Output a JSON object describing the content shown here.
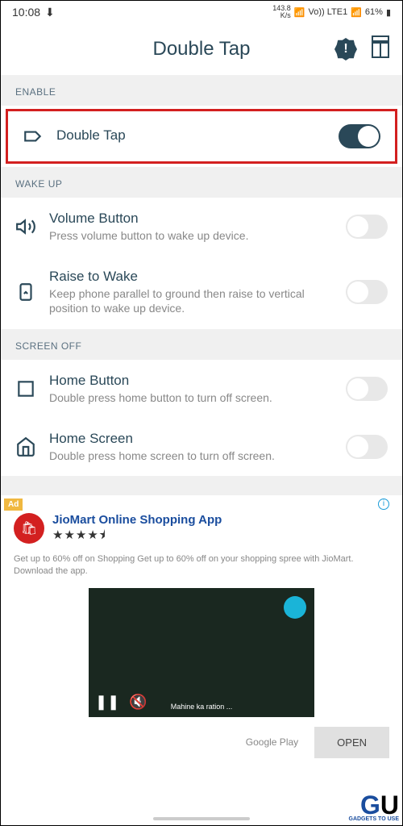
{
  "status": {
    "time": "10:08",
    "speed": "143.8\nK/s",
    "network": "Vo)) LTE1",
    "battery": "61%"
  },
  "header": {
    "title": "Double Tap"
  },
  "sections": {
    "enable": {
      "label": "ENABLE",
      "items": [
        {
          "title": "Double Tap",
          "desc": "",
          "on": true
        }
      ]
    },
    "wakeup": {
      "label": "WAKE UP",
      "items": [
        {
          "title": "Volume Button",
          "desc": "Press volume button to wake up device.",
          "on": false
        },
        {
          "title": "Raise to Wake",
          "desc": "Keep phone parallel to ground then raise to vertical position to wake up device.",
          "on": false
        }
      ]
    },
    "screenoff": {
      "label": "SCREEN OFF",
      "items": [
        {
          "title": "Home Button",
          "desc": "Double press home button to turn off screen.",
          "on": false
        },
        {
          "title": "Home Screen",
          "desc": "Double press home screen to turn off screen.",
          "on": false
        }
      ]
    }
  },
  "ad": {
    "label": "Ad",
    "app_title": "JioMart Online Shopping App",
    "stars": "★★★★⯨",
    "desc": "Get up to 60% off on Shopping Get up to 60% off on your shopping spree with JioMart. Download the app.",
    "caption": "Mahine ka ration ...",
    "source": "Google Play",
    "cta": "OPEN"
  },
  "watermark": "GADGETS TO USE"
}
